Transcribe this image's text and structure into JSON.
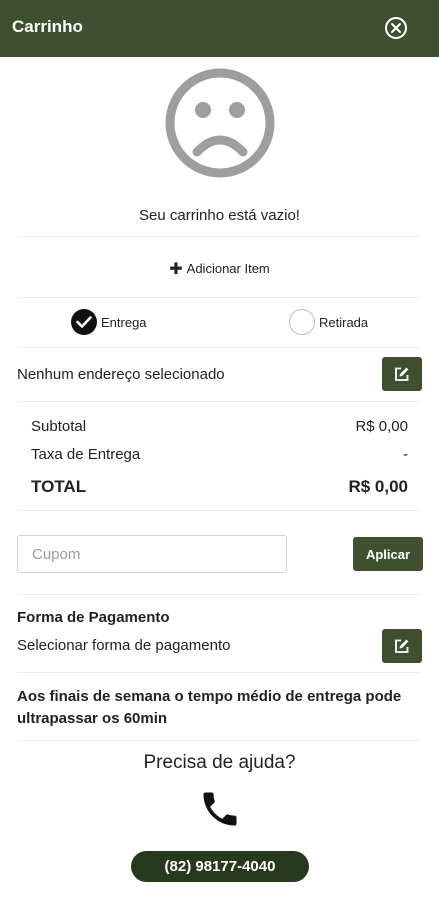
{
  "header": {
    "title": "Carrinho",
    "close_icon": "close-circle-icon"
  },
  "empty_state": {
    "icon": "sad-face-icon",
    "message": "Seu carrinho está vazio!"
  },
  "add_item": {
    "icon": "plus-icon",
    "label": "Adicionar Item"
  },
  "delivery_options": [
    {
      "label": "Entrega",
      "selected": true
    },
    {
      "label": "Retirada",
      "selected": false
    }
  ],
  "address": {
    "label": "Nenhum endereço selecionado",
    "edit_icon": "edit-icon"
  },
  "summary": {
    "subtotal_label": "Subtotal",
    "subtotal_value": "R$ 0,00",
    "fee_label": "Taxa de Entrega",
    "fee_value": "-",
    "total_label": "TOTAL",
    "total_value": "R$ 0,00"
  },
  "coupon": {
    "placeholder": "Cupom",
    "value": "",
    "apply_label": "Aplicar"
  },
  "payment": {
    "title": "Forma de Pagamento",
    "select_label": "Selecionar forma de pagamento",
    "edit_icon": "edit-icon"
  },
  "notice": "Aos finais de semana o tempo médio de entrega pode ultrapassar os 60min",
  "help": {
    "title": "Precisa de ajuda?",
    "icon": "phone-icon",
    "phone": "(82) 98177-4040"
  },
  "colors": {
    "primary": "#3f5031",
    "phone_pill": "#273a1d",
    "face_gray": "#9e9e9e"
  }
}
